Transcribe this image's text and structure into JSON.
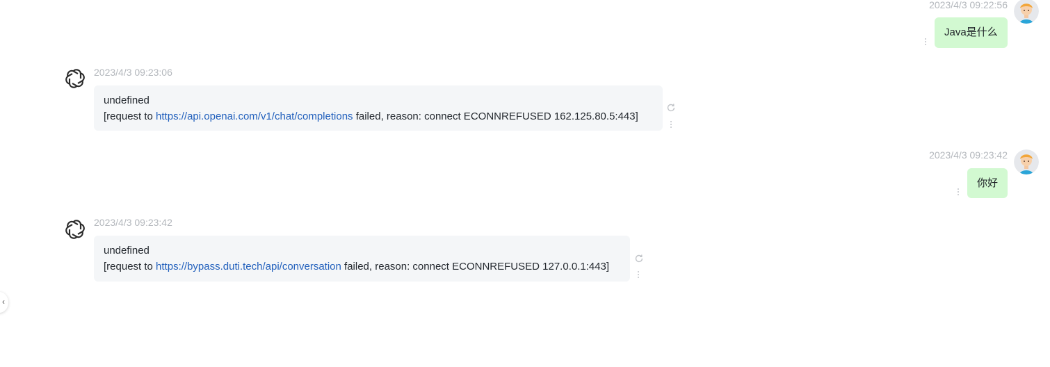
{
  "messages": [
    {
      "role": "user",
      "time": "2023/4/3 09:22:56",
      "text": "Java是什么"
    },
    {
      "role": "assistant",
      "time": "2023/4/3 09:23:06",
      "line1": "undefined",
      "prefix": "[request to ",
      "link": "https://api.openai.com/v1/chat/completions",
      "suffix": " failed, reason: connect ECONNREFUSED 162.125.80.5:443]"
    },
    {
      "role": "user",
      "time": "2023/4/3 09:23:42",
      "text": "你好"
    },
    {
      "role": "assistant",
      "time": "2023/4/3 09:23:42",
      "line1": "undefined",
      "prefix": "[request to ",
      "link": "https://bypass.duti.tech/api/conversation",
      "suffix": " failed, reason: connect ECONNREFUSED 127.0.0.1:443]"
    }
  ],
  "icons": {
    "user_avatar": "user-avatar-icon",
    "bot_avatar": "openai-logo-icon",
    "more": "more-vertical-icon",
    "refresh": "refresh-icon",
    "collapse": "chevron-left-icon"
  },
  "colors": {
    "user_bubble": "#d2f9d1",
    "bot_bubble": "#f4f6f8",
    "link": "#2361bd",
    "timestamp": "#b3b7bc"
  }
}
